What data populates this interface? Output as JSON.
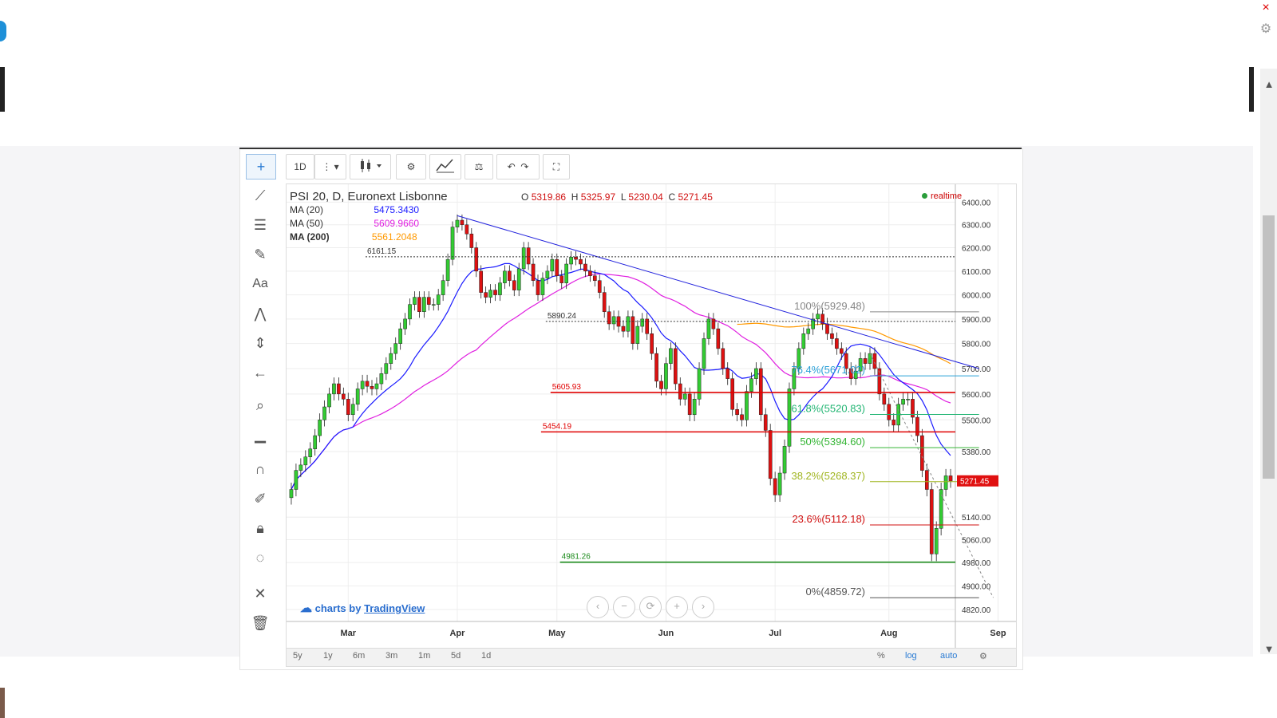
{
  "window": {
    "close_glyph": "×",
    "gear_glyph": "⚙"
  },
  "toolbar": {
    "interval": "1D",
    "more": "⋮",
    "dropdown": "▾"
  },
  "header": {
    "symbol_title": "PSI 20, D, Euronext Lisbonne",
    "o_label": "O",
    "o": "5319.86",
    "h_label": "H",
    "h": "5325.97",
    "l_label": "L",
    "l": "5230.04",
    "c_label": "C",
    "c": "5271.45",
    "realtime": "realtime"
  },
  "indicators": [
    {
      "label": "MA (20)",
      "value": "5475.3430",
      "color": "#1a1aff"
    },
    {
      "label": "MA (50)",
      "value": "5609.9660",
      "color": "#e020e0"
    },
    {
      "label": "MA (200)",
      "value": "5561.2048",
      "color": "#ff9900"
    }
  ],
  "branding": {
    "prefix": "charts by",
    "name": "TradingView"
  },
  "range_buttons": [
    "5y",
    "1y",
    "6m",
    "3m",
    "1m",
    "5d",
    "1d"
  ],
  "scale_buttons": {
    "pct": "%",
    "log": "log",
    "auto": "auto"
  },
  "nav_buttons": [
    "‹",
    "−",
    "⟳",
    "+",
    "›"
  ],
  "chart_data": {
    "type": "candlestick",
    "title": "PSI 20, D, Euronext Lisbonne",
    "y_scale": "log",
    "ylim": [
      4780,
      6480
    ],
    "y_ticks": [
      6400,
      6300,
      6200,
      6100,
      6000,
      5900,
      5800,
      5700,
      5600,
      5500,
      5380,
      5140,
      5060,
      4980,
      4900,
      4820
    ],
    "y_tick_labels": [
      "6400.00",
      "6300.00",
      "6200.00",
      "6100.00",
      "6000.00",
      "5900.00",
      "5800.00",
      "5700.00",
      "5600.00",
      "5500.00",
      "5380.00",
      "5140.00",
      "5060.00",
      "4980.00",
      "4900.00",
      "4820.00"
    ],
    "x_months": [
      {
        "label": "Mar",
        "index": 12
      },
      {
        "label": "Apr",
        "index": 35
      },
      {
        "label": "May",
        "index": 56
      },
      {
        "label": "Jun",
        "index": 79
      },
      {
        "label": "Jul",
        "index": 102
      },
      {
        "label": "Aug",
        "index": 126
      },
      {
        "label": "Sep",
        "index": 149
      }
    ],
    "last_price": 5271.45,
    "last_price_label": "5271.45",
    "candles_close": [
      5240,
      5310,
      5330,
      5360,
      5390,
      5440,
      5500,
      5550,
      5600,
      5640,
      5600,
      5580,
      5520,
      5560,
      5620,
      5650,
      5630,
      5620,
      5640,
      5680,
      5720,
      5760,
      5800,
      5860,
      5900,
      5960,
      5990,
      5930,
      5990,
      5960,
      5960,
      6000,
      6060,
      6150,
      6290,
      6320,
      6300,
      6260,
      6200,
      6100,
      6010,
      5990,
      6020,
      6000,
      6050,
      6100,
      6060,
      6020,
      6110,
      6200,
      6130,
      6060,
      6000,
      6070,
      6100,
      6150,
      6080,
      6050,
      6130,
      6160,
      6150,
      6130,
      6100,
      6080,
      6060,
      6010,
      5930,
      5880,
      5910,
      5870,
      5850,
      5910,
      5800,
      5870,
      5900,
      5840,
      5760,
      5650,
      5620,
      5720,
      5780,
      5640,
      5580,
      5600,
      5520,
      5580,
      5700,
      5820,
      5900,
      5860,
      5780,
      5700,
      5660,
      5540,
      5520,
      5500,
      5610,
      5660,
      5700,
      5520,
      5460,
      5280,
      5220,
      5300,
      5400,
      5620,
      5700,
      5780,
      5840,
      5860,
      5900,
      5920,
      5880,
      5840,
      5820,
      5780,
      5760,
      5700,
      5660,
      5690,
      5740,
      5720,
      5760,
      5700,
      5600,
      5560,
      5500,
      5480,
      5560,
      5580,
      5580,
      5510,
      5440,
      5310,
      5240,
      5010,
      5100,
      5240,
      5290,
      5271
    ],
    "annotations": {
      "horizontal_lines": [
        {
          "value": 6161.15,
          "label": "6161.15",
          "color": "#333",
          "style": "dotted"
        },
        {
          "value": 5890.24,
          "label": "5890.24",
          "color": "#333",
          "style": "dotted"
        },
        {
          "value": 5605.93,
          "label": "5605.93",
          "color": "#e00000",
          "style": "solid"
        },
        {
          "value": 5454.19,
          "label": "5454.19",
          "color": "#e00000",
          "style": "solid"
        },
        {
          "value": 4981.26,
          "label": "4981.26",
          "color": "#1b8a1b",
          "style": "solid"
        }
      ],
      "fibonacci": [
        {
          "label": "100%(5929.48)",
          "value": 5929.48,
          "color": "#888"
        },
        {
          "label": "76.4%(5671.02)",
          "value": 5671.02,
          "color": "#2aa0d8"
        },
        {
          "label": "61.8%(5520.83)",
          "value": 5520.83,
          "color": "#22b573"
        },
        {
          "label": "50%(5394.60)",
          "value": 5394.6,
          "color": "#34b534"
        },
        {
          "label": "38.2%(5268.37)",
          "value": 5268.37,
          "color": "#a0b520"
        },
        {
          "label": "23.6%(5112.18)",
          "value": 5112.18,
          "color": "#d01010"
        },
        {
          "label": "0%(4859.72)",
          "value": 4859.72,
          "color": "#555"
        }
      ]
    }
  }
}
